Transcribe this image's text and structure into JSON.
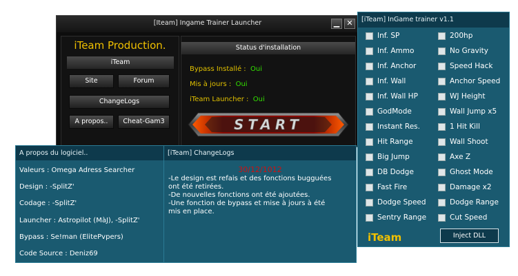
{
  "launcher": {
    "title": "[Iteam] Ingame Trainer Launcher",
    "minimize": "▁",
    "close": "✕",
    "brand": "iTeam Production.",
    "section_iteam": "iTeam",
    "site": "Site",
    "forum": "Forum",
    "changelogs": "ChangeLogs",
    "about": "A propos..",
    "cheat": "Cheat-Gam3",
    "status_header": "Status d'installation",
    "status": [
      {
        "label": "Bypass Installé :",
        "value": "Oui"
      },
      {
        "label": "Mis à jours :",
        "value": "Oui"
      },
      {
        "label": "iTeam Launcher :",
        "value": "Oui"
      }
    ],
    "start_label": "START"
  },
  "about": {
    "title": "A propos du logiciel..",
    "lines": [
      "Valeurs : Omega Adress Searcher",
      "Design : -SplitZ'",
      "Codage : -SplitZ'",
      "Launcher :  Astropilot (MàJ), -SplitZ'",
      "Bypass : Se!man (ElitePvpers)",
      "Code Source : Deniz69"
    ]
  },
  "changelog": {
    "title": "[iTeam] ChangeLogs",
    "date": "30/12/1012",
    "lines": [
      "-Le design est refais et des fonctions bugguées",
      "ont été retirées.",
      "-De nouvelles fonctions ont été  ajoutées.",
      "-Une fonction de bypass et mise à jours à été",
      "mis en place."
    ]
  },
  "trainer": {
    "title": "[iTeam] InGame trainer v1.1",
    "left": [
      "Inf. SP",
      "Inf. Ammo",
      "Inf. Anchor",
      "Inf. Wall",
      "Inf. Wall HP",
      "GodMode",
      "Instant Res.",
      "Hit Range",
      "Big Jump",
      "DB Dodge",
      "Fast Fire",
      "Dodge Speed",
      "Sentry Range"
    ],
    "right": [
      "200hp",
      "No Gravity",
      "Speed Hack",
      "Anchor Speed",
      "WJ Height",
      "Wall Jump x5",
      "1 Hit Kill",
      "Wall Shoot",
      "Axe Z",
      "Ghost Mode",
      "Damage x2",
      "Dodge Range",
      "Cut Speed"
    ],
    "brand": "iTeam",
    "inject": "Inject DLL"
  },
  "colors": {
    "brand_yellow": "#f0c000",
    "ok_green": "#33e000",
    "panel_blue": "#1a5a70",
    "date_red": "#d01010"
  }
}
